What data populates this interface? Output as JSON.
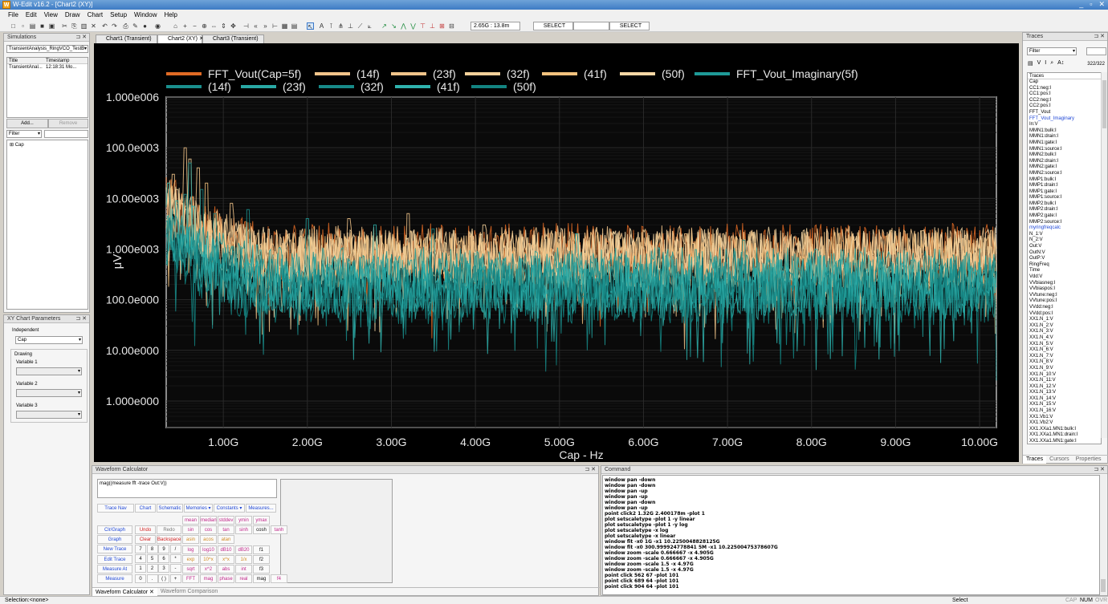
{
  "window": {
    "title": "W-Edit v16.2 - [Chart2 (XY)]",
    "app_icon": "W",
    "controls": [
      "_",
      "▫",
      "✕"
    ]
  },
  "menu": [
    "File",
    "Edit",
    "View",
    "Draw",
    "Chart",
    "Setup",
    "Window",
    "Help"
  ],
  "toolbar": {
    "coord_readout": "2.65G : 13.8m",
    "select1": "SELECT",
    "select2": "SELECT"
  },
  "simulations": {
    "title": "Simulations",
    "dropdown": "TransientAnalysis_RingVCO_TestB",
    "columns": [
      "Title",
      "Timestamp"
    ],
    "rows": [
      {
        "title": "TransientAnal...",
        "timestamp": "12:18:31 Mo..."
      }
    ],
    "add_label": "Add...",
    "remove_label": "Remove",
    "filter_label": "Filter",
    "tree_item": "Cap"
  },
  "xy_params": {
    "title": "XY Chart Parameters",
    "independent_label": "Independent",
    "independent_value": "Cap",
    "drawing_label": "Drawing",
    "var1": "Variable 1",
    "var2": "Variable 2",
    "var3": "Variable 3"
  },
  "doc_tabs": [
    "Chart1 (Transient)",
    "Chart2 (XY)",
    "Chart3 (Transient)"
  ],
  "chart_data": {
    "type": "line",
    "xlabel": "Cap - Hz",
    "ylabel": "μV",
    "x_ticks": [
      "1.00G",
      "2.00G",
      "3.00G",
      "4.00G",
      "5.00G",
      "6.00G",
      "7.00G",
      "8.00G",
      "9.00G",
      "10.00G"
    ],
    "x_tick_values": [
      1,
      2,
      3,
      4,
      5,
      6,
      7,
      8,
      9,
      10
    ],
    "y_ticks": [
      "1.000e006",
      "100.0e003",
      "10.00e003",
      "1.000e003",
      "100.0e000",
      "10.00e000",
      "1.000e000"
    ],
    "y_tick_values": [
      1000000,
      100000,
      10000,
      1000,
      100,
      10,
      1
    ],
    "x_range": [
      0.32,
      10.2
    ],
    "y_scale": "log",
    "ylim": [
      0.3,
      1000000
    ],
    "grid": true,
    "legend_position": "top",
    "series": [
      {
        "name": "FFT_Vout(Cap=5f)",
        "color": "#e06a24",
        "level": 900,
        "peaks": [
          [
            0.35,
            1200
          ],
          [
            0.5,
            2000
          ],
          [
            1,
            400
          ],
          [
            2,
            220
          ],
          [
            3,
            180
          ]
        ]
      },
      {
        "name": "(14f)",
        "color": "#f2c48a",
        "level": 800,
        "peaks": [
          [
            0.4,
            30000
          ],
          [
            0.55,
            100000
          ],
          [
            0.7,
            40000
          ],
          [
            1.1,
            8000
          ],
          [
            2.5,
            4000
          ]
        ]
      },
      {
        "name": "(23f)",
        "color": "#f0c48a",
        "level": 700,
        "peaks": [
          [
            0.35,
            20000
          ],
          [
            0.5,
            6000
          ],
          [
            3.2,
            5000
          ]
        ]
      },
      {
        "name": "(32f)",
        "color": "#f4d19a",
        "level": 650,
        "peaks": [
          [
            0.45,
            15000
          ],
          [
            0.6,
            60000
          ],
          [
            4.1,
            3000
          ]
        ]
      },
      {
        "name": "(41f)",
        "color": "#f2c27e",
        "level": 600,
        "peaks": [
          [
            0.5,
            8000
          ],
          [
            0.8,
            20000
          ],
          [
            6.5,
            2000
          ]
        ]
      },
      {
        "name": "(50f)",
        "color": "#f6d7a5",
        "level": 750,
        "peaks": [
          [
            0.4,
            5000
          ],
          [
            1.2,
            3000
          ],
          [
            8.5,
            1500
          ]
        ]
      },
      {
        "name": "FFT_Vout_Imaginary(5f)",
        "color": "#1e9a97",
        "level": 300,
        "peaks": [
          [
            0.35,
            20000
          ],
          [
            0.6,
            50000
          ],
          [
            2,
            4000
          ]
        ]
      },
      {
        "name": "(14f)",
        "color": "#1a8f8d",
        "level": 250,
        "peaks": [
          [
            0.55,
            12000
          ],
          [
            1.3,
            6000
          ]
        ]
      },
      {
        "name": "(23f)",
        "color": "#29a8a4",
        "level": 200,
        "peaks": [
          [
            0.45,
            9000
          ],
          [
            2.8,
            3000
          ]
        ]
      },
      {
        "name": "(32f)",
        "color": "#178a88",
        "level": 180,
        "peaks": [
          [
            0.75,
            15000
          ],
          [
            3.5,
            2500
          ]
        ]
      },
      {
        "name": "(41f)",
        "color": "#2fb3ae",
        "level": 150,
        "peaks": [
          [
            0.65,
            7000
          ],
          [
            5.2,
            2000
          ]
        ]
      },
      {
        "name": "(50f)",
        "color": "#138481",
        "level": 120,
        "peaks": [
          [
            0.9,
            5000
          ],
          [
            7.2,
            1500
          ]
        ]
      }
    ]
  },
  "traces_panel": {
    "title": "Traces",
    "filter": "Filter",
    "count": "322/322",
    "list_header": "Traces",
    "items": [
      "Cap",
      "CC1:neg:I",
      "CC1:pos:I",
      "CC2:neg:I",
      "CC2:pos:I",
      "FFT_Vout",
      "FFT_Vout_Imaginary",
      "In:V",
      "MMN1:bulk:I",
      "MMN1:drain:I",
      "MMN1:gate:I",
      "MMN1:source:I",
      "MMN2:bulk:I",
      "MMN2:drain:I",
      "MMN2:gate:I",
      "MMN2:source:I",
      "MMP1:bulk:I",
      "MMP1:drain:I",
      "MMP1:gate:I",
      "MMP1:source:I",
      "MMP2:bulk:I",
      "MMP2:drain:I",
      "MMP2:gate:I",
      "MMP2:source:I",
      "myringfreqcalc",
      "N_1:V",
      "N_2:V",
      "Out:V",
      "OutN:V",
      "OutP:V",
      "RingFreq",
      "Time",
      "Vdd:V",
      "VVbiasneg:I",
      "VVbiaspos:I",
      "VVtune:neg:I",
      "VVtune:pos:I",
      "VVdd:neg:I",
      "VVdd:pos:I",
      "XX1.N_1:V",
      "XX1.N_2:V",
      "XX1.N_3:V",
      "XX1.N_4:V",
      "XX1.N_5:V",
      "XX1.N_6:V",
      "XX1.N_7:V",
      "XX1.N_8:V",
      "XX1.N_9:V",
      "XX1.N_10:V",
      "XX1.N_11:V",
      "XX1.N_12:V",
      "XX1.N_13:V",
      "XX1.N_14:V",
      "XX1.N_15:V",
      "XX1.N_16:V",
      "XX1.Vb1:V",
      "XX1.Vb2:V",
      "XX1.XXa1.MN1:bulk:I",
      "XX1.XXa1.MN1:drain:I",
      "XX1.XXa1.MN1:gate:I"
    ],
    "highlight": [
      "FFT_Vout_Imaginary",
      "myringfreqcalc"
    ],
    "bottom_tabs": [
      "Traces",
      "Cursors",
      "Properties"
    ]
  },
  "calculator": {
    "title": "Waveform Calculator",
    "expression": "mag((measure fft -trace Out:V))",
    "top_buttons": [
      "Trace Nav",
      "Chart",
      "Schematic",
      "Memories ▾",
      "Constants ▾",
      "Measures..."
    ],
    "left_buttons": [
      "Clr/Graph",
      "Graph",
      "New Trace",
      "Edit Trace",
      "Measure At",
      "Measure"
    ],
    "stats": [
      "mean",
      "median",
      "stddev",
      "ymin",
      "ymax"
    ],
    "edit_buttons": [
      "Undo",
      "Redo",
      "Clear",
      "Backspace"
    ],
    "keypad": [
      [
        "7",
        "8",
        "9",
        "/"
      ],
      [
        "4",
        "5",
        "6",
        "*"
      ],
      [
        "1",
        "2",
        "3",
        "-"
      ],
      [
        "0",
        ".",
        "( )",
        "+"
      ]
    ],
    "funcs": [
      [
        "sin",
        "cos",
        "tan",
        "sinh",
        "cosh",
        "tanh"
      ],
      [
        "asin",
        "acos",
        "atan",
        "",
        "",
        ""
      ],
      [
        "log",
        "log10",
        "dB10",
        "dB20",
        "f1",
        ""
      ],
      [
        "exp",
        "10^x",
        "x^x",
        "1/x",
        "f2",
        ""
      ],
      [
        "sqrt",
        "x^2",
        "abs",
        "int",
        "f3",
        ""
      ],
      [
        "FFT",
        "mag",
        "phase",
        "real",
        "mag",
        "f4"
      ]
    ],
    "tabs": [
      "Waveform Calculator",
      "Waveform Comparison"
    ]
  },
  "command": {
    "title": "Command",
    "lines": [
      "window pan -down",
      "window pan -down",
      "window pan -up",
      "window pan -up",
      "window pan -down",
      "window pan -up",
      "point click2 1.32G 2.400178m -plot 1",
      "plot setscaletype -plot 1 -y linear",
      "plot setscaletype -plot 1 -y log",
      "plot setscaletype -x log",
      "plot setscaletype -x linear",
      "window fit -x0 1G -x1 10.2250048828125G",
      "window fit -x0 300.999924778841 5M -x1 10.22500475378607G",
      "window zoom -scale 0.666667 -x 4.905G",
      "window zoom -scale 0.666667 -x 4.905G",
      "window zoom -scale 1.5 -x 4.97G",
      "window zoom -scale 1.5 -x 4.97G",
      "point click 562 67 -plot 101",
      "point click 689 64 -plot 101",
      "point click 904 64 -plot 101"
    ]
  },
  "status": {
    "left": "Selection:<none>",
    "middle": "Select",
    "caps": "CAP",
    "num": "NUM",
    "ovr": "OVR"
  }
}
